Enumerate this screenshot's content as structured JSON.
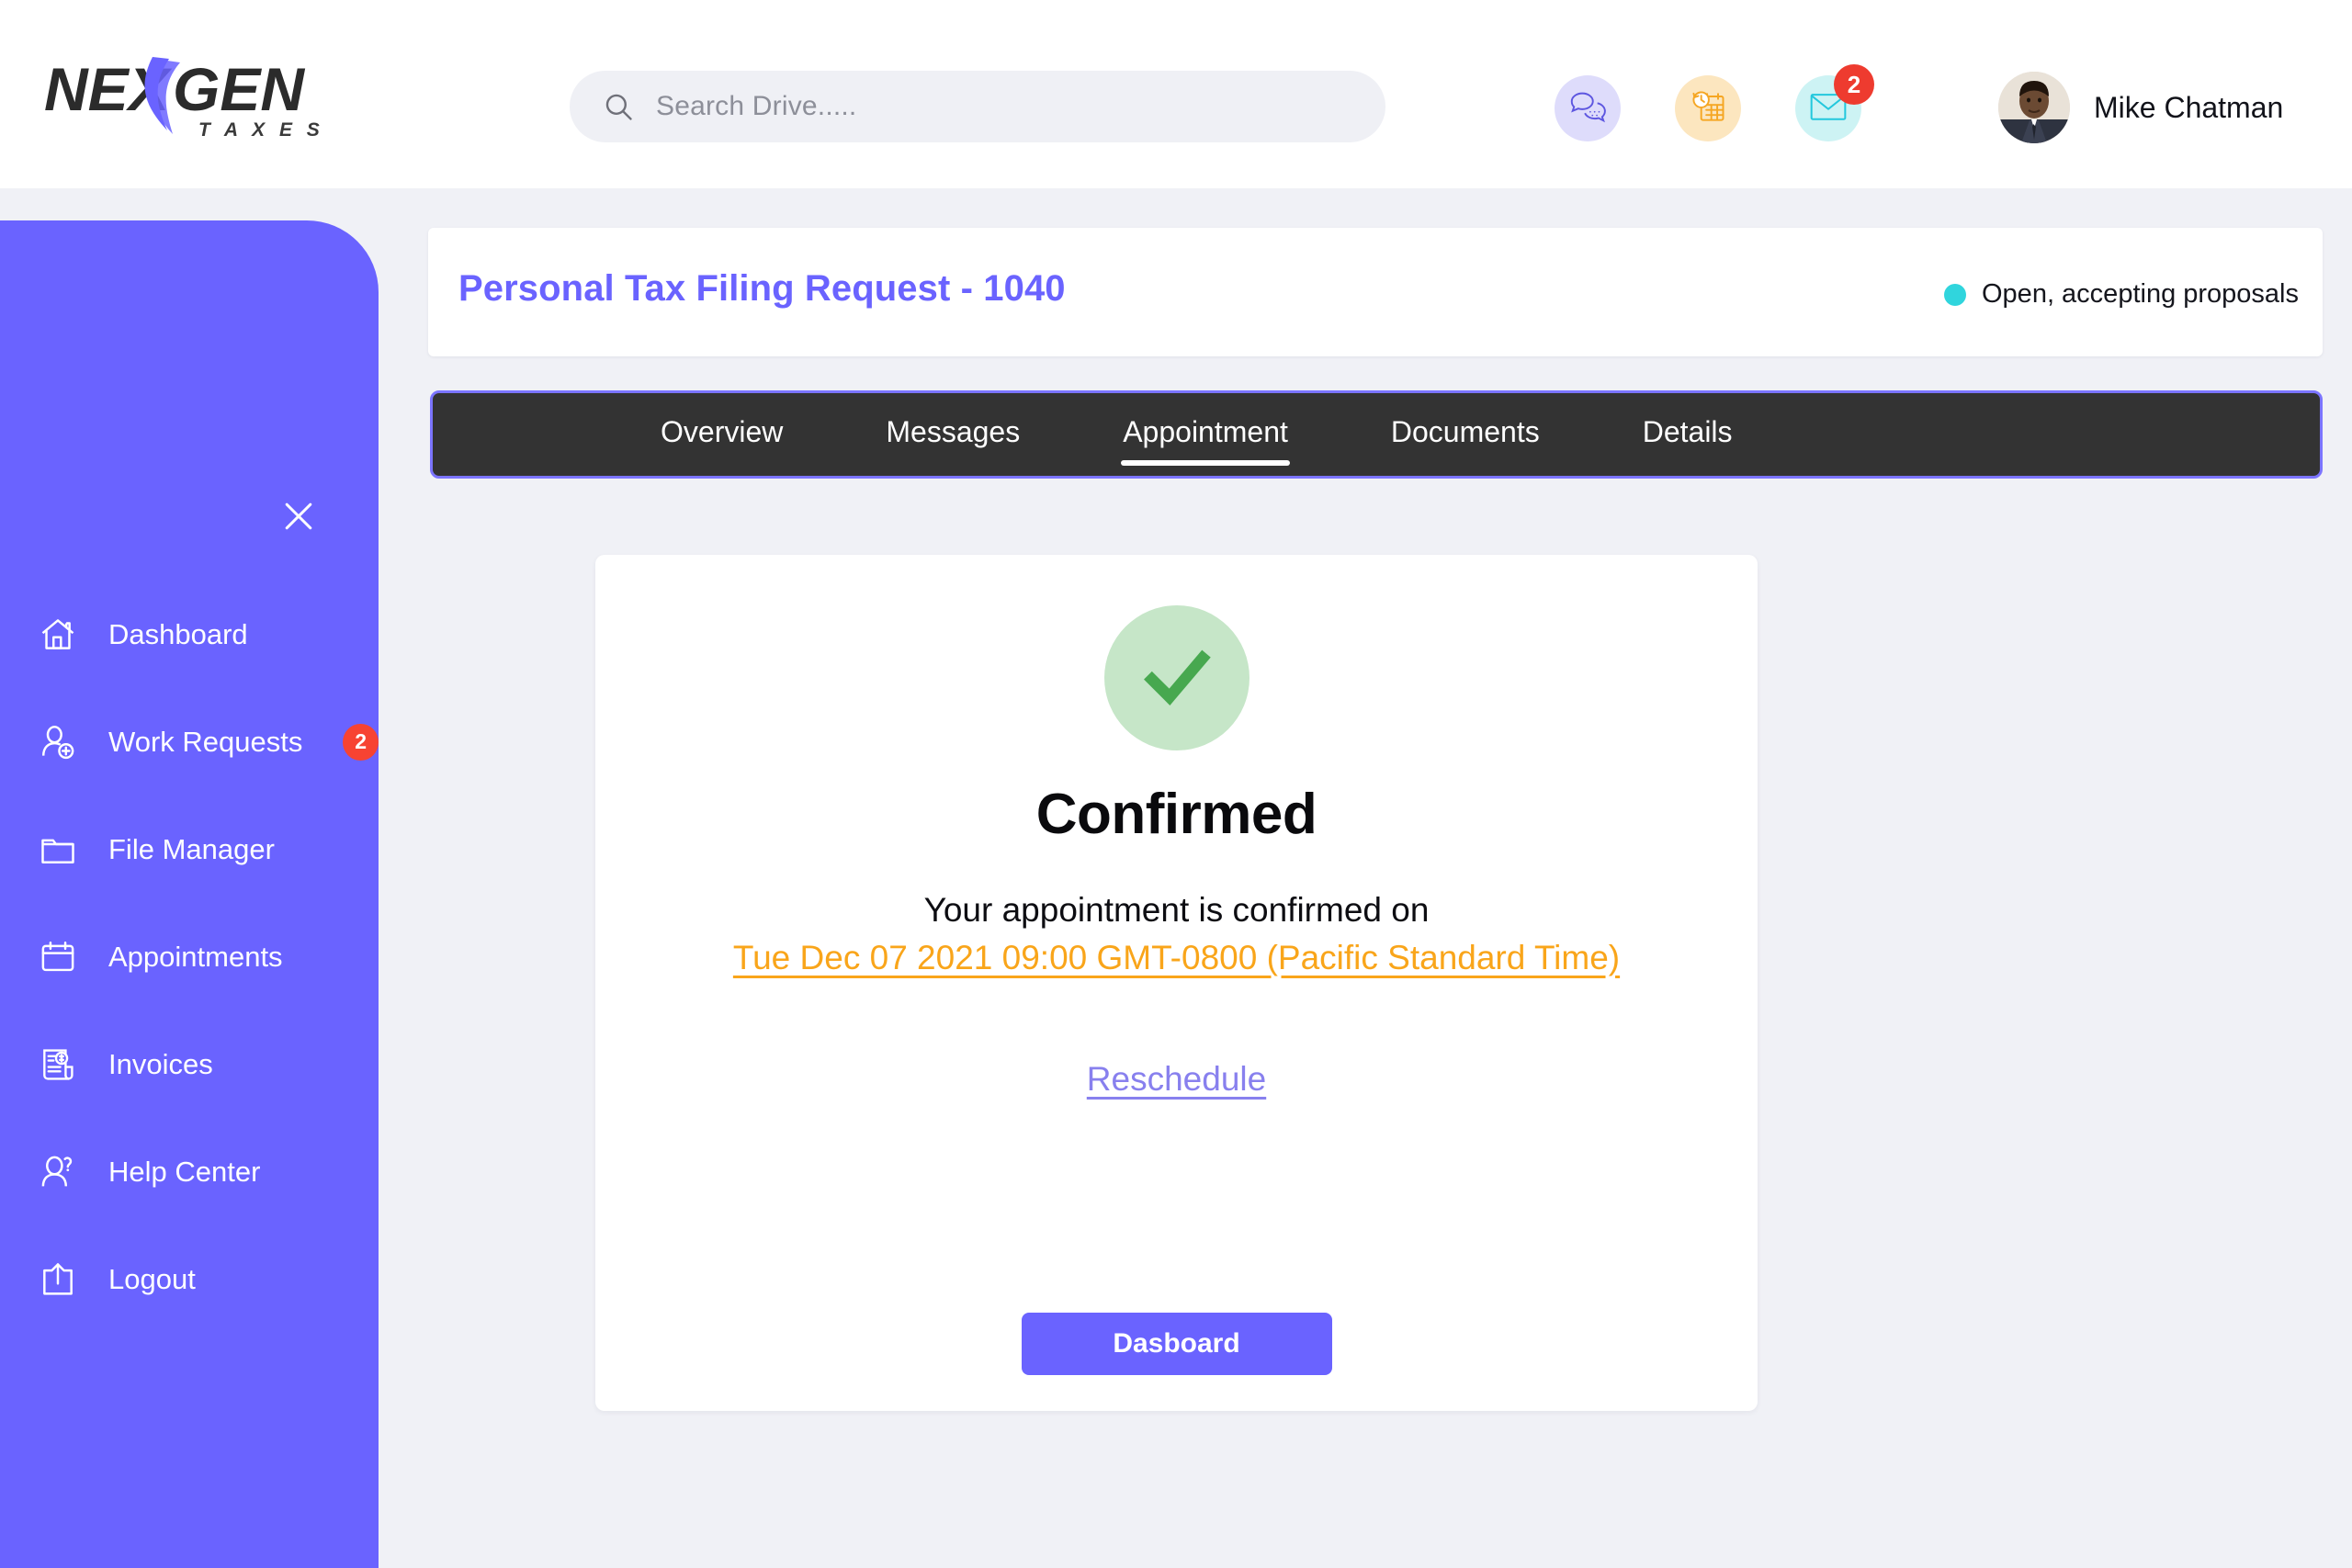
{
  "brand": {
    "name_dark_1": "NE",
    "name_dark_2": "GEN",
    "name_x": "X",
    "tagline": "T A X E S"
  },
  "header": {
    "search": {
      "placeholder": "Search Drive.....",
      "value": "",
      "icon": "search-icon"
    },
    "icons": [
      {
        "name": "chat-icon",
        "bg": "#dedcfb"
      },
      {
        "name": "calendar-clock-icon",
        "bg": "#fce6bf"
      },
      {
        "name": "mail-icon",
        "bg": "#cdf3f4",
        "badge": "2"
      }
    ],
    "mail_badge": "2",
    "user": {
      "name": "Mike Chatman",
      "avatar": "user-photo"
    }
  },
  "sidebar": {
    "close_icon": "close-icon",
    "bg_color": "#6a63ff",
    "items": [
      {
        "label": "Dashboard",
        "icon": "home-icon"
      },
      {
        "label": "Work Requests",
        "icon": "user-add-icon",
        "badge": "2"
      },
      {
        "label": "File Manager",
        "icon": "folder-icon"
      },
      {
        "label": "Appointments",
        "icon": "calendar-icon"
      },
      {
        "label": "Invoices",
        "icon": "invoice-icon"
      },
      {
        "label": "Help Center",
        "icon": "user-help-icon"
      },
      {
        "label": "Logout",
        "icon": "logout-icon"
      }
    ]
  },
  "main": {
    "page_title": "Personal Tax Filing Request - 1040",
    "title_color": "#6a63ff",
    "status": {
      "text": "Open, accepting proposals",
      "dot_color": "#30d5dd"
    },
    "tabs": [
      {
        "label": "Overview",
        "active": false
      },
      {
        "label": "Messages",
        "active": false
      },
      {
        "label": "Appointment",
        "active": true
      },
      {
        "label": "Documents",
        "active": false
      },
      {
        "label": "Details",
        "active": false
      }
    ],
    "confirmation": {
      "icon": "check-icon",
      "icon_bg": "#c6e6c8",
      "heading": "Confirmed",
      "message": "Your appointment is confirmed on",
      "datetime": "Tue Dec 07 2021 09:00 GMT-0800 (Pacific Standard Time)",
      "datetime_color": "#f9a51a",
      "reschedule_label": "Reschedule",
      "reschedule_color": "#8880ee",
      "button_label": "Dasboard",
      "button_color": "#6a63ff"
    }
  }
}
